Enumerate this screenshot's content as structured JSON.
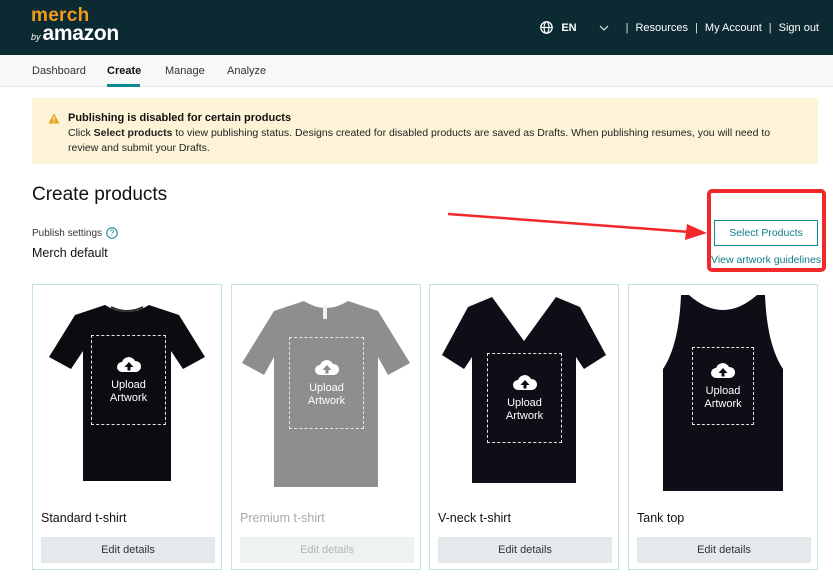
{
  "header": {
    "logo_merch": "merch",
    "logo_by": "by",
    "logo_amazon": "amazon",
    "language": "EN",
    "links": [
      "Resources",
      "My Account",
      "Sign out"
    ],
    "separator": "|"
  },
  "nav": {
    "tabs": [
      {
        "label": "Dashboard",
        "active": false
      },
      {
        "label": "Create",
        "active": true
      },
      {
        "label": "Manage",
        "active": false
      },
      {
        "label": "Analyze",
        "active": false
      }
    ]
  },
  "alert": {
    "title": "Publishing is disabled for certain products",
    "body_prefix": "Click ",
    "body_bold": "Select products",
    "body_suffix": " to view publishing status. Designs created for disabled products are saved as Drafts. When publishing resumes, you will need to review and submit your Drafts.",
    "color": "#fdf3d6"
  },
  "main": {
    "title": "Create products",
    "publish_label": "Publish settings",
    "publish_value": "Merch default",
    "select_button": "Select Products",
    "guidelines_link": "View artwork guidelines"
  },
  "products": [
    {
      "name": "Standard t-shirt",
      "button": "Edit details",
      "upload_line1": "Upload",
      "upload_line2": "Artwork",
      "shirt_color": "#0c0c10",
      "disabled": false
    },
    {
      "name": "Premium t-shirt",
      "button": "Edit details",
      "upload_line1": "Upload",
      "upload_line2": "Artwork",
      "shirt_color": "#8e8e8c",
      "disabled": true
    },
    {
      "name": "V-neck t-shirt",
      "button": "Edit details",
      "upload_line1": "Upload",
      "upload_line2": "Artwork",
      "shirt_color": "#0d0e16",
      "disabled": false
    },
    {
      "name": "Tank top",
      "button": "Edit details",
      "upload_line1": "Upload",
      "upload_line2": "Artwork",
      "shirt_color": "#0d0e16",
      "disabled": false
    }
  ],
  "colors": {
    "header_bg": "#0c2a32",
    "accent": "#0f8894",
    "logo_orange": "#f29b1b",
    "annotation_red": "#f2292b"
  }
}
